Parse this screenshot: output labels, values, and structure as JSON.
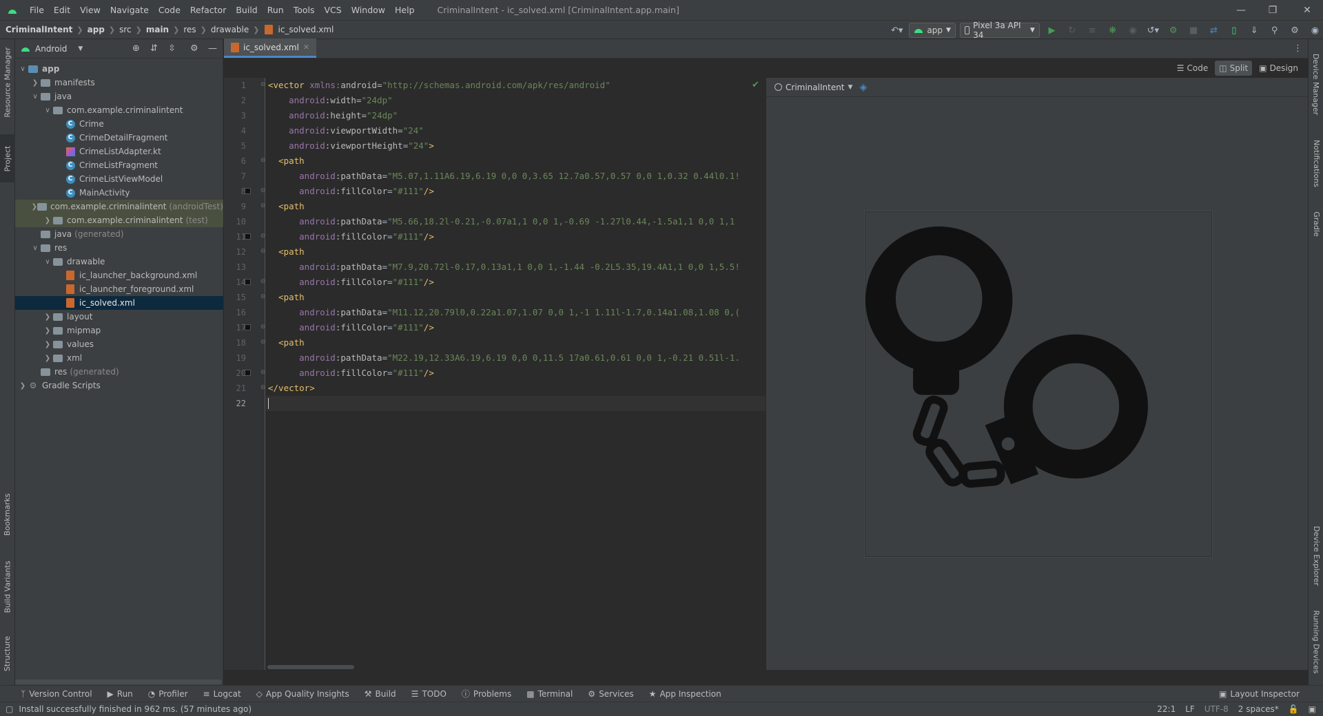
{
  "menu": {
    "items": [
      "File",
      "Edit",
      "View",
      "Navigate",
      "Code",
      "Refactor",
      "Build",
      "Run",
      "Tools",
      "VCS",
      "Window",
      "Help"
    ],
    "title": "CriminalIntent - ic_solved.xml [CriminalIntent.app.main]"
  },
  "breadcrumb": [
    "CriminalIntent",
    "app",
    "src",
    "main",
    "res",
    "drawable",
    "ic_solved.xml"
  ],
  "run_toolbar": {
    "config": "app",
    "device": "Pixel 3a API 34"
  },
  "project": {
    "view_label": "Android",
    "tree": [
      {
        "label": "app",
        "indent": 0,
        "chev": "v",
        "icon": "folder-blue",
        "bold": true
      },
      {
        "label": "manifests",
        "indent": 1,
        "chev": ">",
        "icon": "folder"
      },
      {
        "label": "java",
        "indent": 1,
        "chev": "v",
        "icon": "folder"
      },
      {
        "label": "com.example.criminalintent",
        "indent": 2,
        "chev": "v",
        "icon": "folder"
      },
      {
        "label": "Crime",
        "indent": 3,
        "chev": "",
        "icon": "class"
      },
      {
        "label": "CrimeDetailFragment",
        "indent": 3,
        "chev": "",
        "icon": "class"
      },
      {
        "label": "CrimeListAdapter.kt",
        "indent": 3,
        "chev": "",
        "icon": "kotlin"
      },
      {
        "label": "CrimeListFragment",
        "indent": 3,
        "chev": "",
        "icon": "class"
      },
      {
        "label": "CrimeListViewModel",
        "indent": 3,
        "chev": "",
        "icon": "class"
      },
      {
        "label": "MainActivity",
        "indent": 3,
        "chev": "",
        "icon": "class"
      },
      {
        "label": "com.example.criminalintent",
        "suffix": "(androidTest)",
        "indent": 2,
        "chev": ">",
        "icon": "folder",
        "tint": true
      },
      {
        "label": "com.example.criminalintent",
        "suffix": "(test)",
        "indent": 2,
        "chev": ">",
        "icon": "folder",
        "tint": true
      },
      {
        "label": "java",
        "suffix": "(generated)",
        "indent": 1,
        "chev": "",
        "icon": "folder"
      },
      {
        "label": "res",
        "indent": 1,
        "chev": "v",
        "icon": "folder"
      },
      {
        "label": "drawable",
        "indent": 2,
        "chev": "v",
        "icon": "folder"
      },
      {
        "label": "ic_launcher_background.xml",
        "indent": 3,
        "chev": "",
        "icon": "xml"
      },
      {
        "label": "ic_launcher_foreground.xml",
        "indent": 3,
        "chev": "",
        "icon": "xml"
      },
      {
        "label": "ic_solved.xml",
        "indent": 3,
        "chev": "",
        "icon": "xml",
        "selected": true
      },
      {
        "label": "layout",
        "indent": 2,
        "chev": ">",
        "icon": "folder"
      },
      {
        "label": "mipmap",
        "indent": 2,
        "chev": ">",
        "icon": "folder"
      },
      {
        "label": "values",
        "indent": 2,
        "chev": ">",
        "icon": "folder"
      },
      {
        "label": "xml",
        "indent": 2,
        "chev": ">",
        "icon": "folder"
      },
      {
        "label": "res",
        "suffix": "(generated)",
        "indent": 1,
        "chev": "",
        "icon": "folder"
      },
      {
        "label": "Gradle Scripts",
        "indent": 0,
        "chev": ">",
        "icon": "gradle"
      }
    ]
  },
  "left_stripe": [
    "Resource Manager",
    "Project",
    "Bookmarks",
    "Build Variants",
    "Structure"
  ],
  "right_stripe": [
    "Device Manager",
    "Notifications",
    "Gradle",
    "Device Explorer",
    "Running Devices"
  ],
  "editor": {
    "tab_label": "ic_solved.xml",
    "modes": [
      "Code",
      "Split",
      "Design"
    ],
    "active_mode": "Split",
    "lines": [
      [
        [
          "tag",
          "<vector "
        ],
        [
          "ns",
          "xmlns:"
        ],
        [
          "attr",
          "android"
        ],
        [
          "plain",
          "="
        ],
        [
          "str",
          "\"http://schemas.android.com/apk/res/android\""
        ]
      ],
      [
        [
          "plain",
          "    "
        ],
        [
          "ns",
          "android"
        ],
        [
          "attr",
          ":width"
        ],
        [
          "plain",
          "="
        ],
        [
          "str",
          "\"24dp\""
        ]
      ],
      [
        [
          "plain",
          "    "
        ],
        [
          "ns",
          "android"
        ],
        [
          "attr",
          ":height"
        ],
        [
          "plain",
          "="
        ],
        [
          "str",
          "\"24dp\""
        ]
      ],
      [
        [
          "plain",
          "    "
        ],
        [
          "ns",
          "android"
        ],
        [
          "attr",
          ":viewportWidth"
        ],
        [
          "plain",
          "="
        ],
        [
          "str",
          "\"24\""
        ]
      ],
      [
        [
          "plain",
          "    "
        ],
        [
          "ns",
          "android"
        ],
        [
          "attr",
          ":viewportHeight"
        ],
        [
          "plain",
          "="
        ],
        [
          "str",
          "\"24\""
        ],
        [
          "tag",
          ">"
        ]
      ],
      [
        [
          "plain",
          "  "
        ],
        [
          "tag",
          "<path"
        ]
      ],
      [
        [
          "plain",
          "      "
        ],
        [
          "ns",
          "android"
        ],
        [
          "attr",
          ":pathData"
        ],
        [
          "plain",
          "="
        ],
        [
          "str",
          "\"M5.07,1.11A6.19,6.19 0,0 0,3.65 12.7a0.57,0.57 0,0 1,0.32 0.44l0.1!"
        ]
      ],
      [
        [
          "plain",
          "      "
        ],
        [
          "ns",
          "android"
        ],
        [
          "attr",
          ":fillColor"
        ],
        [
          "plain",
          "="
        ],
        [
          "str",
          "\"#111\""
        ],
        [
          "tag",
          "/>"
        ]
      ],
      [
        [
          "plain",
          "  "
        ],
        [
          "tag",
          "<path"
        ]
      ],
      [
        [
          "plain",
          "      "
        ],
        [
          "ns",
          "android"
        ],
        [
          "attr",
          ":pathData"
        ],
        [
          "plain",
          "="
        ],
        [
          "str",
          "\"M5.66,18.2l-0.21,-0.07a1,1 0,0 1,-0.69 -1.27l0.44,-1.5a1,1 0,0 1,1"
        ]
      ],
      [
        [
          "plain",
          "      "
        ],
        [
          "ns",
          "android"
        ],
        [
          "attr",
          ":fillColor"
        ],
        [
          "plain",
          "="
        ],
        [
          "str",
          "\"#111\""
        ],
        [
          "tag",
          "/>"
        ]
      ],
      [
        [
          "plain",
          "  "
        ],
        [
          "tag",
          "<path"
        ]
      ],
      [
        [
          "plain",
          "      "
        ],
        [
          "ns",
          "android"
        ],
        [
          "attr",
          ":pathData"
        ],
        [
          "plain",
          "="
        ],
        [
          "str",
          "\"M7.9,20.72l-0.17,0.13a1,1 0,0 1,-1.44 -0.2L5.35,19.4A1,1 0,0 1,5.5!"
        ]
      ],
      [
        [
          "plain",
          "      "
        ],
        [
          "ns",
          "android"
        ],
        [
          "attr",
          ":fillColor"
        ],
        [
          "plain",
          "="
        ],
        [
          "str",
          "\"#111\""
        ],
        [
          "tag",
          "/>"
        ]
      ],
      [
        [
          "plain",
          "  "
        ],
        [
          "tag",
          "<path"
        ]
      ],
      [
        [
          "plain",
          "      "
        ],
        [
          "ns",
          "android"
        ],
        [
          "attr",
          ":pathData"
        ],
        [
          "plain",
          "="
        ],
        [
          "str",
          "\"M11.12,20.79l0,0.22a1.07,1.07 0,0 1,-1 1.11l-1.7,0.14a1.08,1.08 0,("
        ]
      ],
      [
        [
          "plain",
          "      "
        ],
        [
          "ns",
          "android"
        ],
        [
          "attr",
          ":fillColor"
        ],
        [
          "plain",
          "="
        ],
        [
          "str",
          "\"#111\""
        ],
        [
          "tag",
          "/>"
        ]
      ],
      [
        [
          "plain",
          "  "
        ],
        [
          "tag",
          "<path"
        ]
      ],
      [
        [
          "plain",
          "      "
        ],
        [
          "ns",
          "android"
        ],
        [
          "attr",
          ":pathData"
        ],
        [
          "plain",
          "="
        ],
        [
          "str",
          "\"M22.19,12.33A6.19,6.19 0,0 0,11.5 17a0.61,0.61 0,0 1,-0.21 0.51l-1."
        ]
      ],
      [
        [
          "plain",
          "      "
        ],
        [
          "ns",
          "android"
        ],
        [
          "attr",
          ":fillColor"
        ],
        [
          "plain",
          "="
        ],
        [
          "str",
          "\"#111\""
        ],
        [
          "tag",
          "/>"
        ]
      ],
      [
        [
          "tag",
          "</vector>"
        ]
      ],
      [
        [
          "plain",
          ""
        ]
      ]
    ],
    "swatch_lines": [
      8,
      11,
      14,
      17,
      20
    ],
    "fold_lines": [
      1,
      6,
      8,
      9,
      11,
      12,
      14,
      15,
      17,
      18,
      20,
      21
    ]
  },
  "preview": {
    "theme_label": "CriminalIntent"
  },
  "tool_windows": [
    "Version Control",
    "Run",
    "Profiler",
    "Logcat",
    "App Quality Insights",
    "Build",
    "TODO",
    "Problems",
    "Terminal",
    "Services",
    "App Inspection"
  ],
  "layout_inspector": "Layout Inspector",
  "status": {
    "message": "Install successfully finished in 962 ms. (57 minutes ago)",
    "position": "22:1",
    "line_sep": "LF",
    "encoding": "UTF-8",
    "indent": "2 spaces*"
  },
  "colors": {
    "fill": "#111111",
    "accent": "#4a88c7",
    "run_green": "#499c54"
  }
}
